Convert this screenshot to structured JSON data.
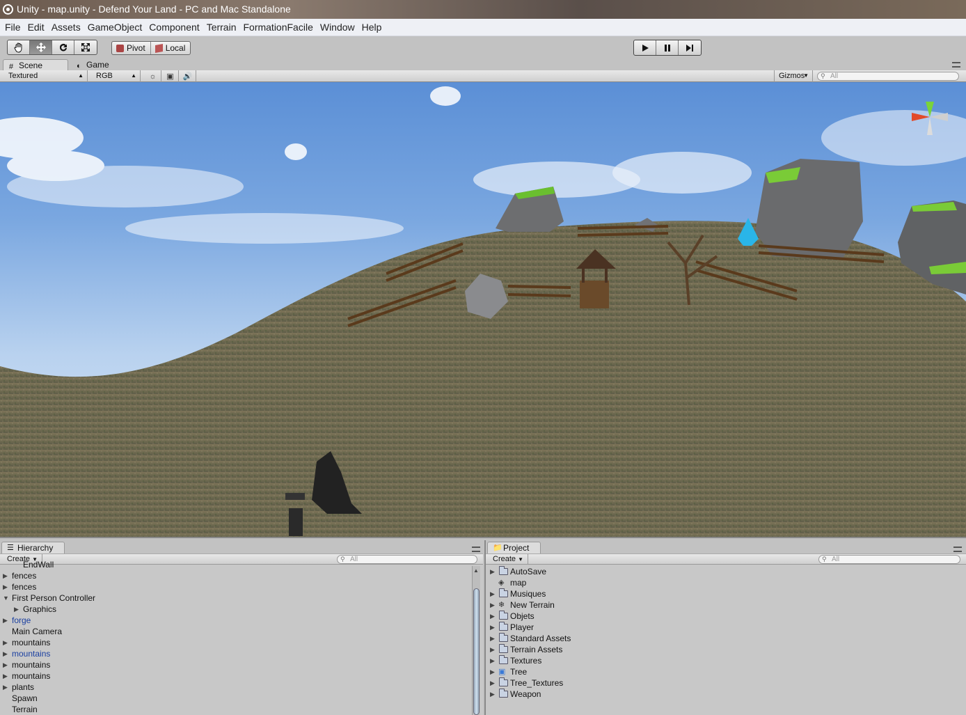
{
  "window": {
    "title": "Unity - map.unity - Defend Your Land - PC and Mac Standalone"
  },
  "menu": [
    "File",
    "Edit",
    "Assets",
    "GameObject",
    "Component",
    "Terrain",
    "FormationFacile",
    "Window",
    "Help"
  ],
  "toolbar": {
    "transform_tools": [
      "hand-icon",
      "move-icon",
      "rotate-icon",
      "scale-icon"
    ],
    "active_tool": "move-icon",
    "pivot_label": "Pivot",
    "local_label": "Local",
    "playback": [
      "play-icon",
      "pause-icon",
      "step-icon"
    ]
  },
  "scene_tabs": {
    "scene": "Scene",
    "game": "Game",
    "active": "Scene"
  },
  "scene_bar": {
    "render_mode": "Textured",
    "channel": "RGB",
    "gizmos": "Gizmos",
    "search_placeholder": "All"
  },
  "hierarchy": {
    "tab": "Hierarchy",
    "create": "Create",
    "search_placeholder": "All",
    "items": [
      {
        "label": "EndWall",
        "indent": 1,
        "expandable": false,
        "blue": false
      },
      {
        "label": "fences",
        "indent": 0,
        "expandable": true,
        "blue": false
      },
      {
        "label": "fences",
        "indent": 0,
        "expandable": true,
        "blue": false
      },
      {
        "label": "First Person Controller",
        "indent": 0,
        "expandable": true,
        "expanded": true,
        "blue": false
      },
      {
        "label": "Graphics",
        "indent": 1,
        "expandable": true,
        "blue": false
      },
      {
        "label": "forge",
        "indent": 0,
        "expandable": true,
        "blue": true
      },
      {
        "label": "Main Camera",
        "indent": 0,
        "expandable": false,
        "blue": false
      },
      {
        "label": "mountains",
        "indent": 0,
        "expandable": true,
        "blue": false
      },
      {
        "label": "mountains",
        "indent": 0,
        "expandable": true,
        "blue": true
      },
      {
        "label": "mountains",
        "indent": 0,
        "expandable": true,
        "blue": false
      },
      {
        "label": "mountains",
        "indent": 0,
        "expandable": true,
        "blue": false
      },
      {
        "label": "plants",
        "indent": 0,
        "expandable": true,
        "blue": false
      },
      {
        "label": "Spawn",
        "indent": 0,
        "expandable": false,
        "blue": false
      },
      {
        "label": "Terrain",
        "indent": 0,
        "expandable": false,
        "blue": false
      }
    ]
  },
  "project": {
    "tab": "Project",
    "create": "Create",
    "search_placeholder": "All",
    "items": [
      {
        "label": "AutoSave",
        "icon": "folder-icon",
        "expandable": true
      },
      {
        "label": "map",
        "icon": "unity-scene-icon",
        "expandable": false
      },
      {
        "label": "Musiques",
        "icon": "folder-icon",
        "expandable": true
      },
      {
        "label": "New Terrain",
        "icon": "terrain-icon",
        "expandable": true
      },
      {
        "label": "Objets",
        "icon": "folder-icon",
        "expandable": true
      },
      {
        "label": "Player",
        "icon": "folder-icon",
        "expandable": true
      },
      {
        "label": "Standard Assets",
        "icon": "folder-icon",
        "expandable": true
      },
      {
        "label": "Terrain Assets",
        "icon": "folder-icon",
        "expandable": true
      },
      {
        "label": "Textures",
        "icon": "folder-icon",
        "expandable": true
      },
      {
        "label": "Tree",
        "icon": "prefab-icon",
        "expandable": true
      },
      {
        "label": "Tree_Textures",
        "icon": "folder-icon",
        "expandable": true
      },
      {
        "label": "Weapon",
        "icon": "folder-icon",
        "expandable": true
      }
    ]
  }
}
